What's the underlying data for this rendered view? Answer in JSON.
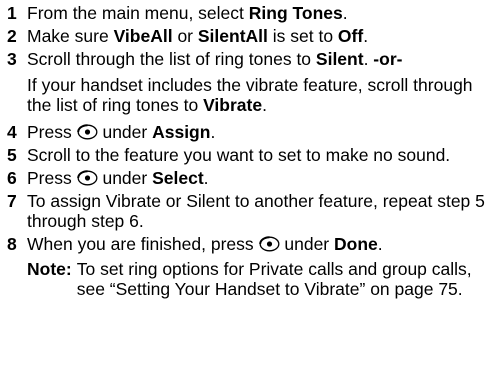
{
  "steps": [
    {
      "number": "1",
      "parts": [
        "From the main menu, select ",
        "Ring Tones",
        "."
      ]
    },
    {
      "number": "2",
      "parts": [
        "Make sure ",
        "VibeAll",
        " or ",
        "SilentAll",
        " is set to ",
        "Off",
        "."
      ]
    },
    {
      "number": "3",
      "parts": [
        "Scroll through the list of ring tones to ",
        "Silent",
        ". ",
        "-or-"
      ],
      "continuation": [
        "If your handset includes the vibrate feature, scroll through the list of ring tones to ",
        "Vibrate",
        "."
      ]
    },
    {
      "number": "4",
      "parts": [
        "Press ",
        " under ",
        "Assign",
        "."
      ],
      "icon": "softkey-icon"
    },
    {
      "number": "5",
      "parts": [
        "Scroll to the feature you want to set to make no sound."
      ]
    },
    {
      "number": "6",
      "parts": [
        "Press ",
        " under ",
        "Select",
        "."
      ],
      "icon": "softkey-icon"
    },
    {
      "number": "7",
      "parts": [
        "To assign Vibrate or Silent to another feature, repeat step 5 through step 6."
      ]
    },
    {
      "number": "8",
      "parts": [
        "When you are finished, press ",
        " under ",
        "Done",
        "."
      ],
      "icon": "softkey-icon"
    }
  ],
  "note": {
    "label": "Note:",
    "text": "To set ring options for Private calls and group calls, see “Setting Your Handset to Vibrate” on page 75."
  }
}
